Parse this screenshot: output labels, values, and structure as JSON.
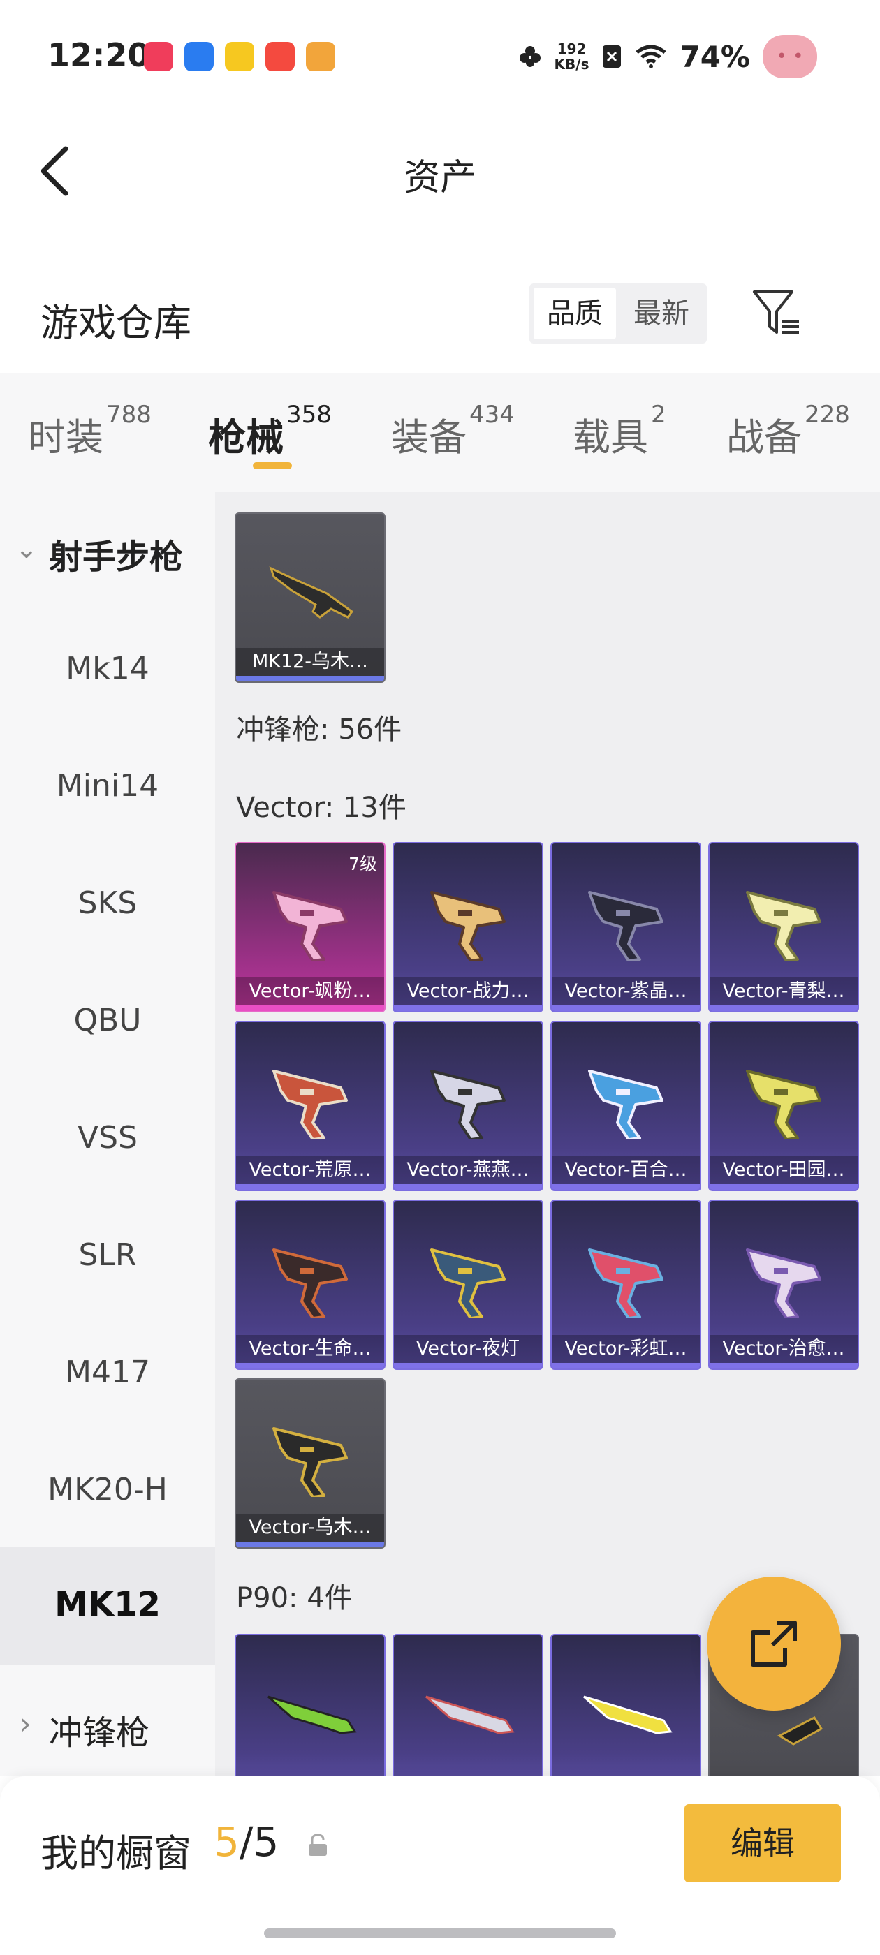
{
  "status_bar": {
    "time": "12:20",
    "speed_value": "192",
    "speed_unit": "KB/s",
    "battery": "74%",
    "app_icons": [
      "video-app-icon",
      "browser-app-icon",
      "news-app-icon",
      "kuaishou-app-icon",
      "game-app-icon"
    ],
    "app_icon_colors": [
      "#f03d5b",
      "#2a7cf0",
      "#f6c820",
      "#f44a3f",
      "#f2a53b"
    ]
  },
  "header": {
    "title": "资产"
  },
  "warehouse": {
    "title": "游戏仓库",
    "sort_quality": "品质",
    "sort_latest": "最新"
  },
  "tabs": [
    {
      "label": "时装",
      "count": "788"
    },
    {
      "label": "枪械",
      "count": "358"
    },
    {
      "label": "装备",
      "count": "434"
    },
    {
      "label": "载具",
      "count": "2"
    },
    {
      "label": "战备",
      "count": "228"
    }
  ],
  "sidebar": {
    "group_expanded": "射手步枪",
    "items": [
      "Mk14",
      "Mini14",
      "SKS",
      "QBU",
      "VSS",
      "SLR",
      "M417",
      "MK20-H"
    ],
    "active_item": "MK12",
    "group_collapsed": "冲锋枪"
  },
  "content": {
    "mk12_card": "MK12-乌木…",
    "smg_header": "冲锋枪: 56件",
    "vector_header": "Vector: 13件",
    "vector_cards": [
      {
        "label": "Vector-飒粉…",
        "rarity": "pink",
        "level": "7级"
      },
      {
        "label": "Vector-战力…",
        "rarity": "purple"
      },
      {
        "label": "Vector-紫晶…",
        "rarity": "purple"
      },
      {
        "label": "Vector-青梨…",
        "rarity": "purple"
      },
      {
        "label": "Vector-荒原…",
        "rarity": "purple"
      },
      {
        "label": "Vector-燕燕…",
        "rarity": "purple"
      },
      {
        "label": "Vector-百合…",
        "rarity": "purple"
      },
      {
        "label": "Vector-田园…",
        "rarity": "purple"
      },
      {
        "label": "Vector-生命…",
        "rarity": "purple"
      },
      {
        "label": "Vector-夜灯",
        "rarity": "purple"
      },
      {
        "label": "Vector-彩虹…",
        "rarity": "purple"
      },
      {
        "label": "Vector-治愈…",
        "rarity": "purple"
      },
      {
        "label": "Vector-乌木…",
        "rarity": "grey"
      }
    ],
    "p90_header": "P90: 4件"
  },
  "showcase": {
    "title": "我的橱窗",
    "current": "5",
    "separator": "/",
    "total": "5",
    "edit_label": "编辑"
  },
  "colors": {
    "accent": "#f3b33d",
    "purple_rarity": "#5c4fa6",
    "pink_rarity": "#c93aa3"
  }
}
